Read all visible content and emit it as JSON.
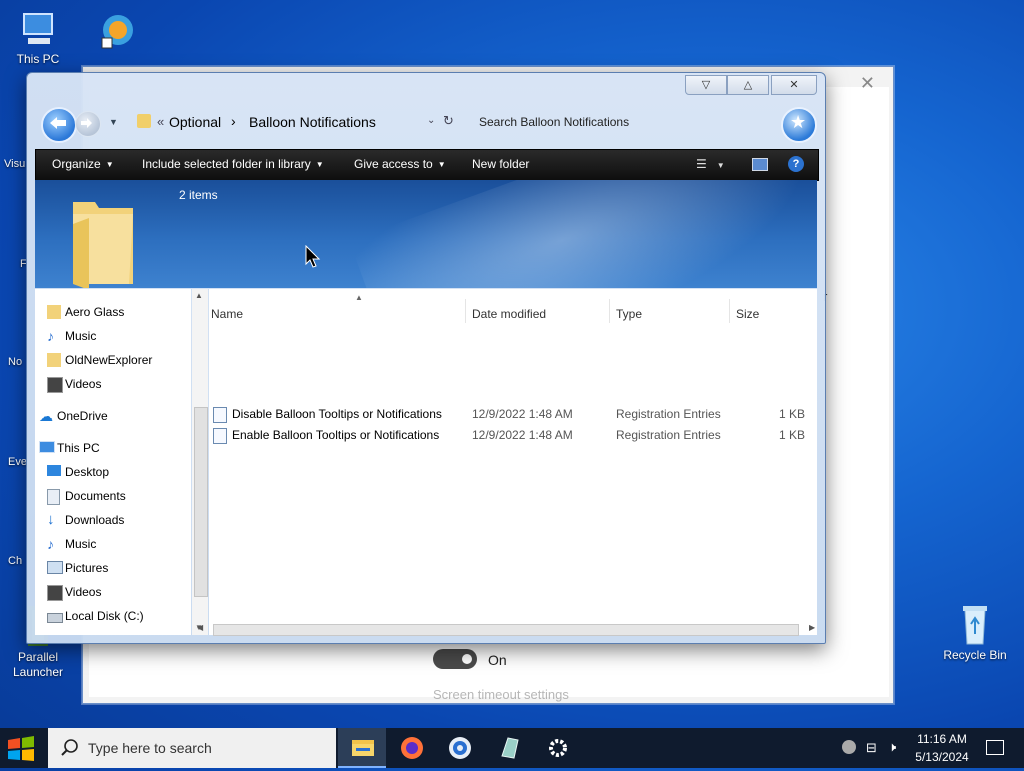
{
  "desktop": {
    "icons": [
      {
        "label": "This PC"
      },
      {
        "label": "Parallel\nLauncher"
      },
      {
        "label": "Recycle Bin"
      }
    ],
    "partial_labels": [
      "Visu",
      "F",
      "No",
      "Eve",
      "Ch"
    ]
  },
  "settings_window": {
    "toggle_label": "On",
    "timeout_text": "Screen timeout settings",
    "edge_letter": "r"
  },
  "explorer": {
    "address": {
      "overflow": "«",
      "segment1": "Optional",
      "separator": "›",
      "segment2": "Balloon Notifications"
    },
    "search_placeholder": "Search Balloon Notifications",
    "toolbar": {
      "organize": "Organize",
      "include": "Include selected folder in library",
      "give_access": "Give access to",
      "new_folder": "New folder"
    },
    "banner": {
      "item_count": "2 items"
    },
    "nav": [
      {
        "label": "Aero Glass",
        "icon": "folder-icon"
      },
      {
        "label": "Music",
        "icon": "music-icon"
      },
      {
        "label": "OldNewExplorer",
        "icon": "folder-icon"
      },
      {
        "label": "Videos",
        "icon": "video-icon"
      },
      {
        "label": "OneDrive",
        "icon": "cloud-icon"
      },
      {
        "label": "This PC",
        "icon": "computer-icon"
      },
      {
        "label": "Desktop",
        "icon": "desktop-icon"
      },
      {
        "label": "Documents",
        "icon": "documents-icon"
      },
      {
        "label": "Downloads",
        "icon": "download-icon"
      },
      {
        "label": "Music",
        "icon": "music-icon"
      },
      {
        "label": "Pictures",
        "icon": "pictures-icon"
      },
      {
        "label": "Videos",
        "icon": "video-icon"
      },
      {
        "label": "Local Disk (C:)",
        "icon": "drive-icon"
      }
    ],
    "columns": {
      "name": "Name",
      "date": "Date modified",
      "type": "Type",
      "size": "Size"
    },
    "files": [
      {
        "name": "Disable Balloon Tooltips or Notifications",
        "date": "12/9/2022 1:48 AM",
        "type": "Registration Entries",
        "size": "1 KB"
      },
      {
        "name": "Enable Balloon Tooltips or Notifications",
        "date": "12/9/2022 1:48 AM",
        "type": "Registration Entries",
        "size": "1 KB"
      }
    ]
  },
  "taskbar": {
    "search_placeholder": "Type here to search",
    "time": "11:16 AM",
    "date": "5/13/2024"
  }
}
